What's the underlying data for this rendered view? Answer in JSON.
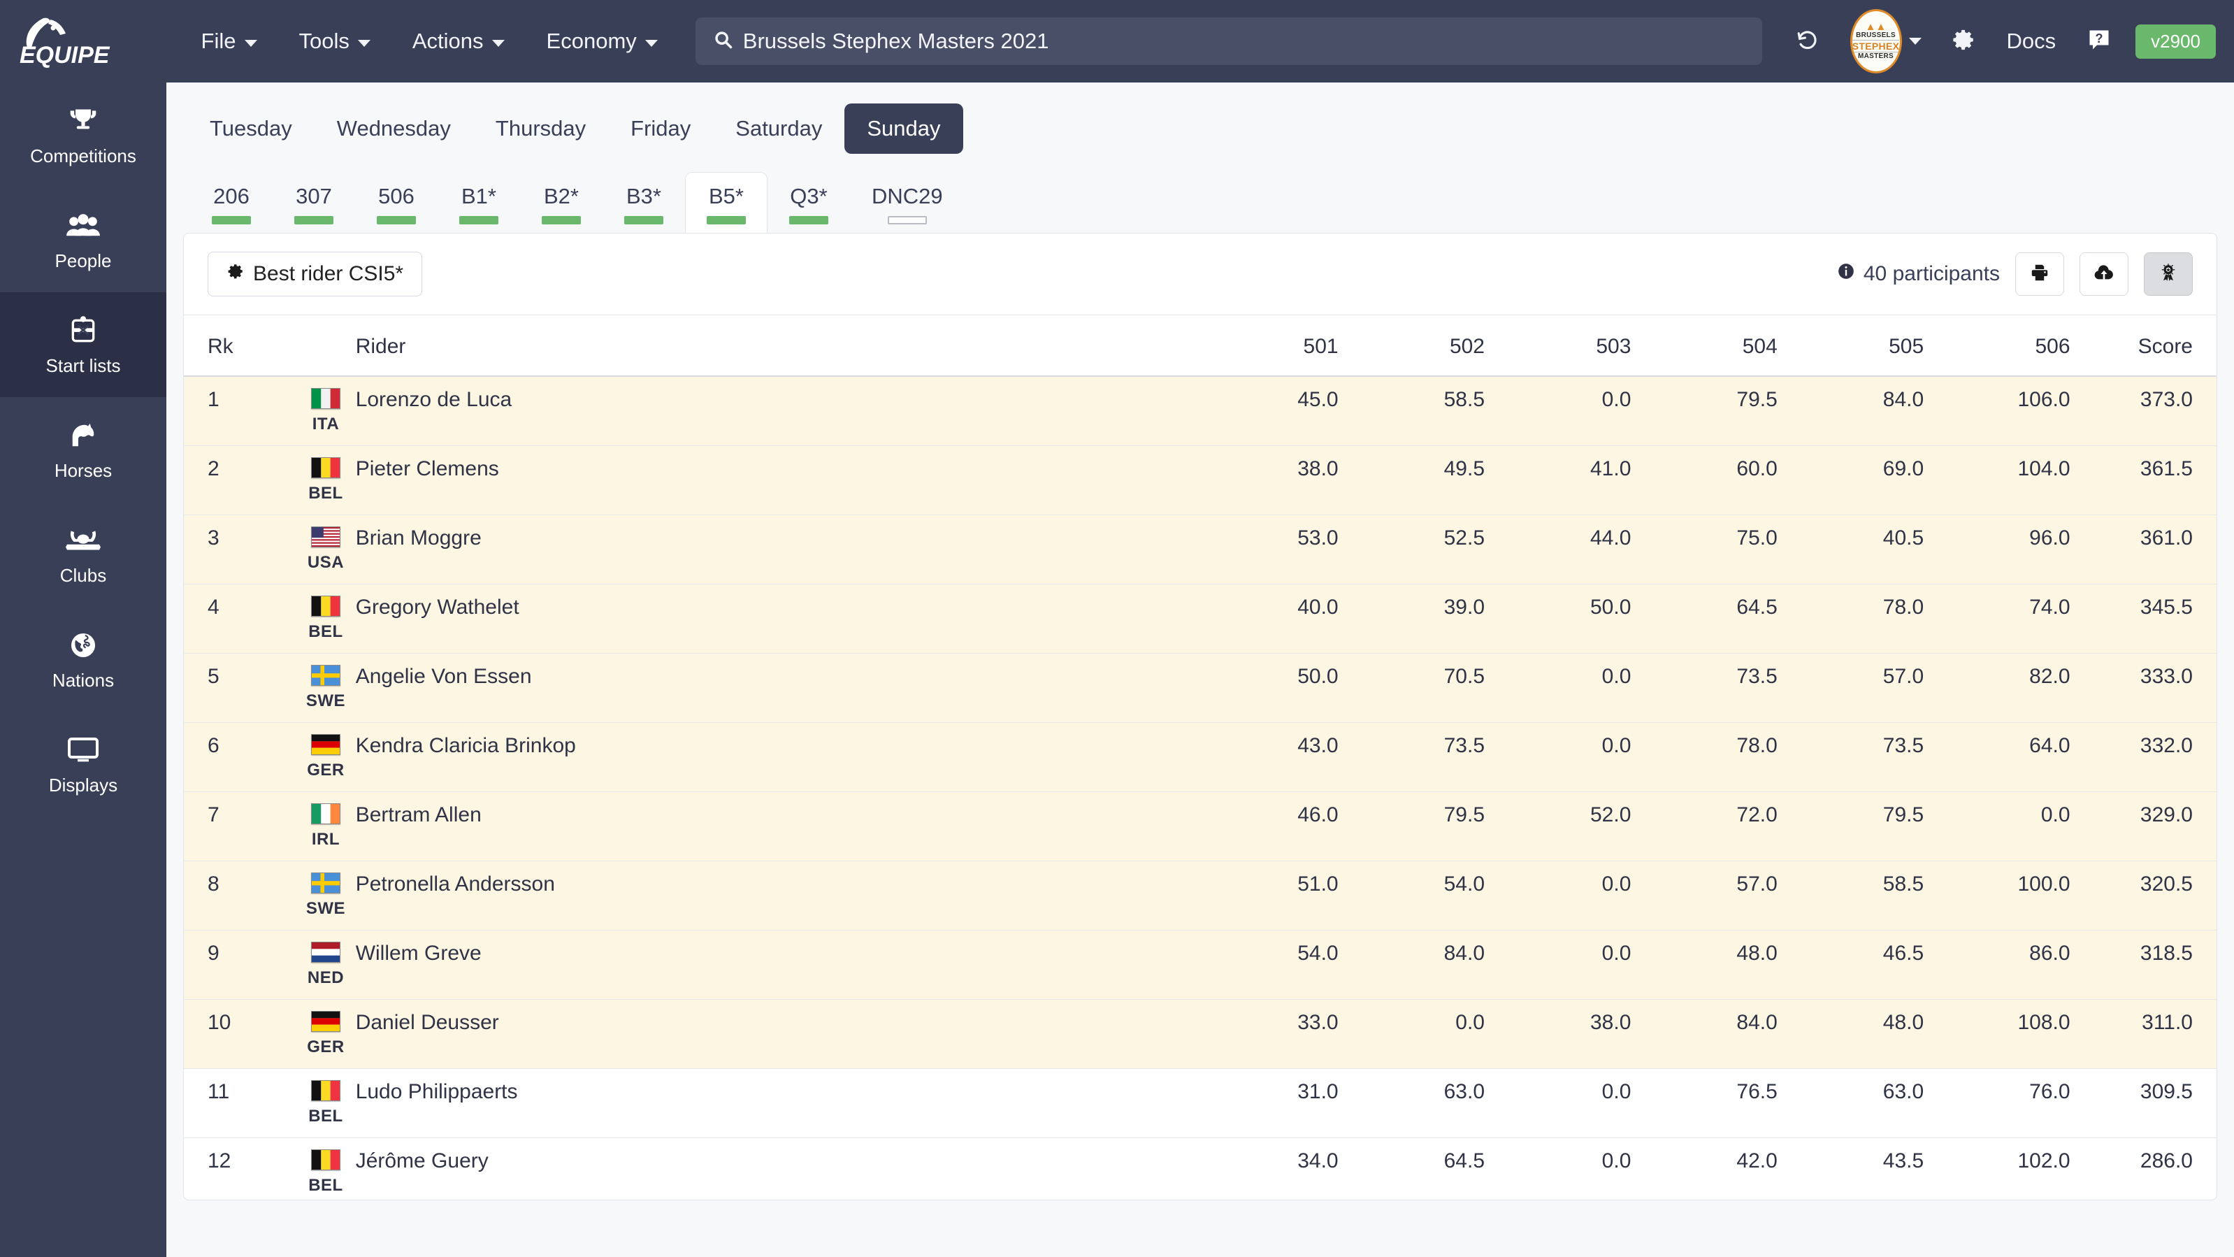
{
  "app": {
    "brand": "EQUIPE",
    "version_label": "v2900"
  },
  "topbar": {
    "menus": [
      {
        "label": "File",
        "icon": "chevron-down-icon"
      },
      {
        "label": "Tools",
        "icon": "chevron-down-icon"
      },
      {
        "label": "Actions",
        "icon": "chevron-down-icon"
      },
      {
        "label": "Economy",
        "icon": "chevron-down-icon"
      }
    ],
    "search": {
      "icon": "search-icon",
      "value": "Brussels Stephex Masters 2021",
      "placeholder": "Search"
    },
    "history_icon": "history-undo-icon",
    "event_badge": {
      "line1": "BRUSSELS",
      "line2": "STEPHEX",
      "line3": "MASTERS",
      "icon": "chevron-down-icon"
    },
    "settings_icon": "gear-icon",
    "docs_label": "Docs",
    "help_icon": "question-mark-icon"
  },
  "sidebar": {
    "items": [
      {
        "label": "Competitions",
        "icon": "trophy-icon",
        "active": false
      },
      {
        "label": "People",
        "icon": "people-icon",
        "active": false
      },
      {
        "label": "Start lists",
        "icon": "clipboard-icon",
        "active": true
      },
      {
        "label": "Horses",
        "icon": "horse-head-icon",
        "active": false
      },
      {
        "label": "Clubs",
        "icon": "club-crest-icon",
        "active": false
      },
      {
        "label": "Nations",
        "icon": "globe-icon",
        "active": false
      },
      {
        "label": "Displays",
        "icon": "monitor-icon",
        "active": false
      }
    ]
  },
  "day_tabs": [
    {
      "label": "Tuesday",
      "active": false
    },
    {
      "label": "Wednesday",
      "active": false
    },
    {
      "label": "Thursday",
      "active": false
    },
    {
      "label": "Friday",
      "active": false
    },
    {
      "label": "Saturday",
      "active": false
    },
    {
      "label": "Sunday",
      "active": true
    }
  ],
  "class_tabs": [
    {
      "label": "206",
      "active": false,
      "bar": "green"
    },
    {
      "label": "307",
      "active": false,
      "bar": "green"
    },
    {
      "label": "506",
      "active": false,
      "bar": "green"
    },
    {
      "label": "B1*",
      "active": false,
      "bar": "green"
    },
    {
      "label": "B2*",
      "active": false,
      "bar": "green"
    },
    {
      "label": "B3*",
      "active": false,
      "bar": "green"
    },
    {
      "label": "B5*",
      "active": true,
      "bar": "green"
    },
    {
      "label": "Q3*",
      "active": false,
      "bar": "green"
    },
    {
      "label": "DNC29",
      "active": false,
      "bar": "empty"
    }
  ],
  "toolbar": {
    "class_button": {
      "label": "Best rider CSI5*",
      "icon": "gear-icon"
    },
    "participants": {
      "icon": "info-icon",
      "text": "40 participants"
    },
    "actions": [
      {
        "name": "print-button",
        "icon": "printer-icon",
        "pressed": false
      },
      {
        "name": "upload-button",
        "icon": "cloud-upload-icon",
        "pressed": false
      },
      {
        "name": "results-button",
        "icon": "rosette-icon",
        "pressed": true
      }
    ]
  },
  "accent_colors": {
    "sidebar_bg": "#3a3f58",
    "sidebar_active": "#2c3047",
    "green_bar": "#69b86b",
    "version_pill": "#69b86b",
    "highlight_row": "#fdf6e3",
    "badge_orange": "#e08b2a"
  },
  "table": {
    "columns": [
      "Rk",
      "Rider",
      "501",
      "502",
      "503",
      "504",
      "505",
      "506",
      "Score"
    ],
    "rows": [
      {
        "rk": "1",
        "nat": "ITA",
        "rider": "Lorenzo de Luca",
        "c501": "45.0",
        "c502": "58.5",
        "c503": "0.0",
        "c504": "79.5",
        "c505": "84.0",
        "c506": "106.0",
        "score": "373.0",
        "highlight": true
      },
      {
        "rk": "2",
        "nat": "BEL",
        "rider": "Pieter Clemens",
        "c501": "38.0",
        "c502": "49.5",
        "c503": "41.0",
        "c504": "60.0",
        "c505": "69.0",
        "c506": "104.0",
        "score": "361.5",
        "highlight": true
      },
      {
        "rk": "3",
        "nat": "USA",
        "rider": "Brian Moggre",
        "c501": "53.0",
        "c502": "52.5",
        "c503": "44.0",
        "c504": "75.0",
        "c505": "40.5",
        "c506": "96.0",
        "score": "361.0",
        "highlight": true
      },
      {
        "rk": "4",
        "nat": "BEL",
        "rider": "Gregory Wathelet",
        "c501": "40.0",
        "c502": "39.0",
        "c503": "50.0",
        "c504": "64.5",
        "c505": "78.0",
        "c506": "74.0",
        "score": "345.5",
        "highlight": true
      },
      {
        "rk": "5",
        "nat": "SWE",
        "rider": "Angelie Von Essen",
        "c501": "50.0",
        "c502": "70.5",
        "c503": "0.0",
        "c504": "73.5",
        "c505": "57.0",
        "c506": "82.0",
        "score": "333.0",
        "highlight": true
      },
      {
        "rk": "6",
        "nat": "GER",
        "rider": "Kendra Claricia Brinkop",
        "c501": "43.0",
        "c502": "73.5",
        "c503": "0.0",
        "c504": "78.0",
        "c505": "73.5",
        "c506": "64.0",
        "score": "332.0",
        "highlight": true
      },
      {
        "rk": "7",
        "nat": "IRL",
        "rider": "Bertram Allen",
        "c501": "46.0",
        "c502": "79.5",
        "c503": "52.0",
        "c504": "72.0",
        "c505": "79.5",
        "c506": "0.0",
        "score": "329.0",
        "highlight": true
      },
      {
        "rk": "8",
        "nat": "SWE",
        "rider": "Petronella Andersson",
        "c501": "51.0",
        "c502": "54.0",
        "c503": "0.0",
        "c504": "57.0",
        "c505": "58.5",
        "c506": "100.0",
        "score": "320.5",
        "highlight": true
      },
      {
        "rk": "9",
        "nat": "NED",
        "rider": "Willem Greve",
        "c501": "54.0",
        "c502": "84.0",
        "c503": "0.0",
        "c504": "48.0",
        "c505": "46.5",
        "c506": "86.0",
        "score": "318.5",
        "highlight": true
      },
      {
        "rk": "10",
        "nat": "GER",
        "rider": "Daniel Deusser",
        "c501": "33.0",
        "c502": "0.0",
        "c503": "38.0",
        "c504": "84.0",
        "c505": "48.0",
        "c506": "108.0",
        "score": "311.0",
        "highlight": true
      },
      {
        "rk": "11",
        "nat": "BEL",
        "rider": "Ludo Philippaerts",
        "c501": "31.0",
        "c502": "63.0",
        "c503": "0.0",
        "c504": "76.5",
        "c505": "63.0",
        "c506": "76.0",
        "score": "309.5",
        "highlight": false
      },
      {
        "rk": "12",
        "nat": "BEL",
        "rider": "Jérôme Guery",
        "c501": "34.0",
        "c502": "64.5",
        "c503": "0.0",
        "c504": "42.0",
        "c505": "43.5",
        "c506": "102.0",
        "score": "286.0",
        "highlight": false
      }
    ]
  }
}
